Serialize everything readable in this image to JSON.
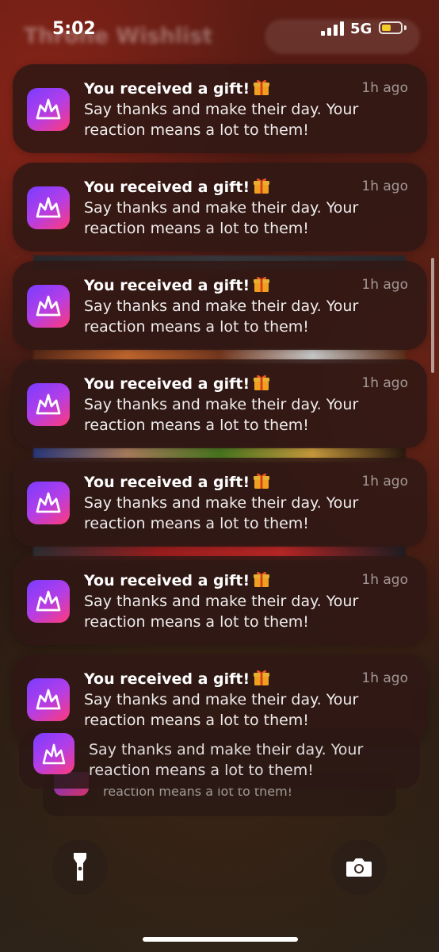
{
  "status_bar": {
    "time": "5:02",
    "network": "5G",
    "battery_level": 0.5
  },
  "background_app": {
    "title": "Throne Wishlist"
  },
  "notifications": [
    {
      "title": "You received a gift!",
      "body": "Say thanks and make their day. Your reaction means a lot to them!",
      "time": "1h ago"
    },
    {
      "title": "You received a gift!",
      "body": "Say thanks and make their day. Your reaction means a lot to them!",
      "time": "1h ago"
    },
    {
      "title": "You received a gift!",
      "body": "Say thanks and make their day. Your reaction means a lot to them!",
      "time": "1h ago"
    },
    {
      "title": "You received a gift!",
      "body": "Say thanks and make their day. Your reaction means a lot to them!",
      "time": "1h ago"
    },
    {
      "title": "You received a gift!",
      "body": "Say thanks and make their day. Your reaction means a lot to them!",
      "time": "1h ago"
    },
    {
      "title": "You received a gift!",
      "body": "Say thanks and make their day. Your reaction means a lot to them!",
      "time": "1h ago"
    },
    {
      "title": "You received a gift!",
      "body": "Say thanks and make their day. Your reaction means a lot to them!",
      "time": "1h ago"
    }
  ],
  "stacked": [
    {
      "body": "Say thanks and make their day. Your reaction means a lot to them!"
    },
    {
      "body": "reaction means a lot to them!"
    }
  ],
  "icons": {
    "app": "crown-icon",
    "gift": "gift-icon",
    "flashlight": "flashlight-icon",
    "camera": "camera-icon"
  },
  "colors": {
    "icon_gradient_start": "#7a3cff",
    "icon_gradient_end": "#ff3a7a",
    "battery": "#f2cc2a"
  }
}
